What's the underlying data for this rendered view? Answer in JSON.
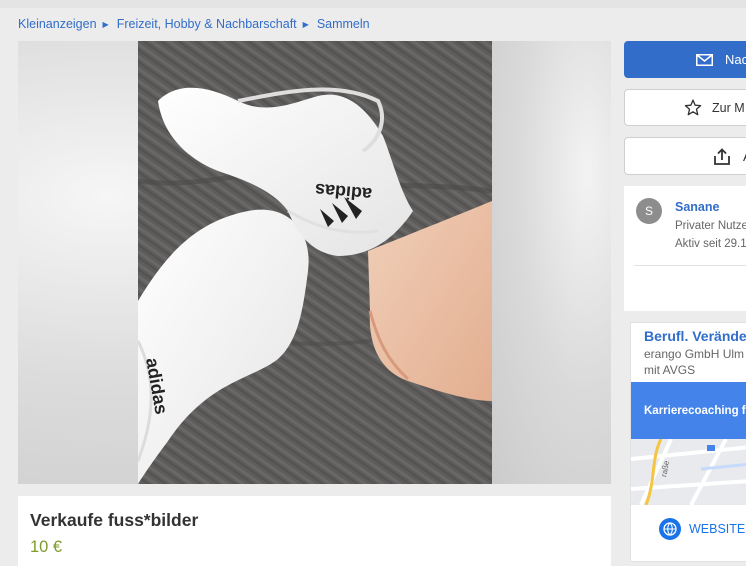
{
  "breadcrumb": [
    {
      "label": "Kleinanzeigen"
    },
    {
      "label": "Freizeit, Hobby & Nachbarschaft"
    },
    {
      "label": "Sammeln"
    }
  ],
  "listing": {
    "title": "Verkaufe fuss*bilder",
    "price": "10 €"
  },
  "actions": {
    "message_label": "Nac",
    "watch_label": "Zur M",
    "share_label": "A"
  },
  "seller": {
    "avatar_initial": "S",
    "name": "Sanane",
    "type": "Privater Nutze",
    "active_since": "Aktiv seit 29.1"
  },
  "ad": {
    "title": "Berufl. Verände",
    "company": "erango GmbH Ulm",
    "description": "mit AVGS",
    "banner": "Karrierecoaching f",
    "map_label": "raße",
    "website_label": "WEBSITE"
  },
  "colors": {
    "accent": "#326dc9",
    "price": "#7e9b2b",
    "ad_banner": "#4484ea"
  }
}
